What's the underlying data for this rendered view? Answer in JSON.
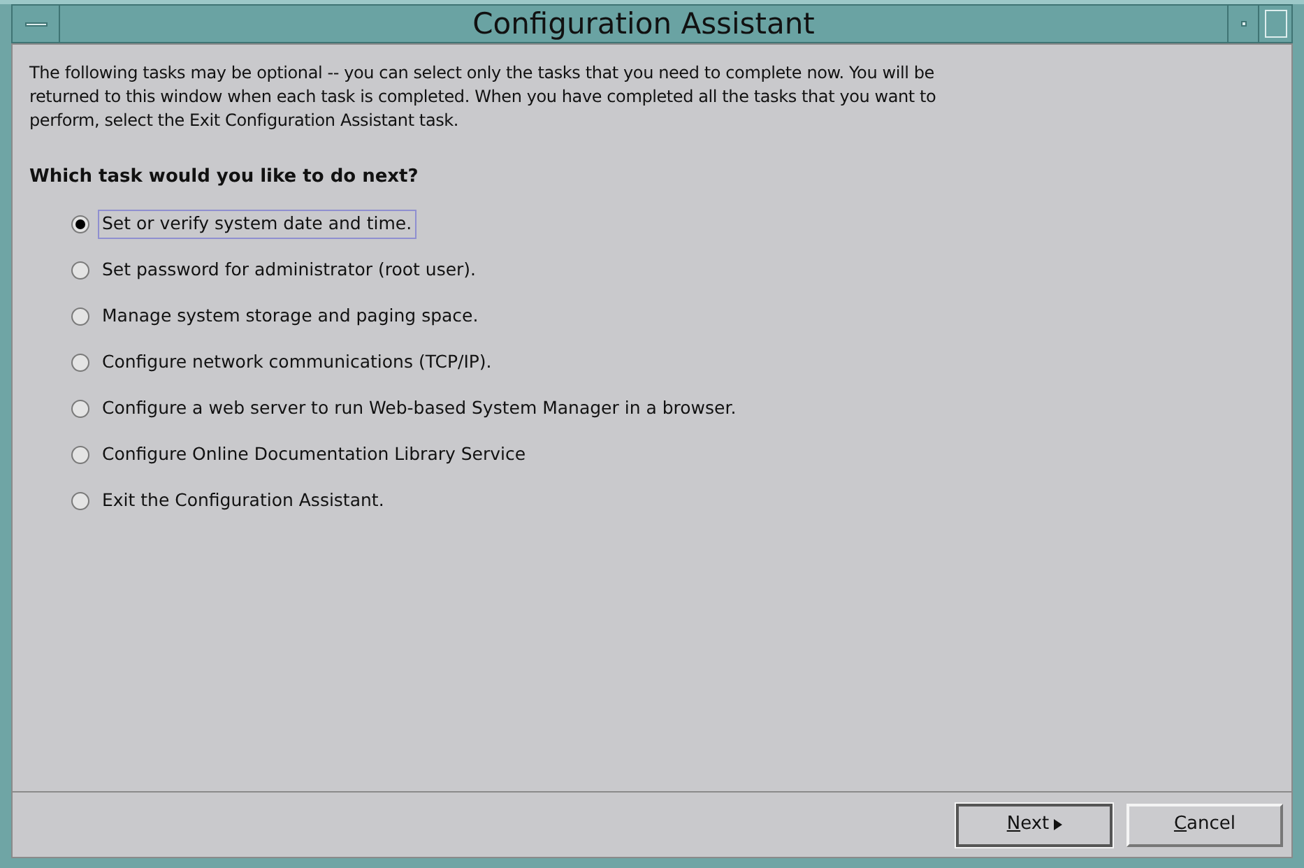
{
  "window": {
    "title": "Configuration Assistant"
  },
  "intro": "The following tasks may be optional -- you can select only the tasks that you need to complete now. You will be returned to this window when each task is completed.  When you have completed all the tasks that you want to perform, select the Exit Configuration Assistant task.",
  "question": "Which task would you like to do next?",
  "options": [
    {
      "label": "Set or verify system date and time.",
      "selected": true
    },
    {
      "label": "Set password for administrator (root user).",
      "selected": false
    },
    {
      "label": "Manage system storage and paging space.",
      "selected": false
    },
    {
      "label": "Configure network communications (TCP/IP).",
      "selected": false
    },
    {
      "label": "Configure a web server to run Web-based System Manager in a browser.",
      "selected": false
    },
    {
      "label": "Configure Online Documentation Library Service",
      "selected": false
    },
    {
      "label": "Exit the Configuration Assistant.",
      "selected": false
    }
  ],
  "buttons": [
    {
      "label": "Next",
      "first_letter_underlined": true,
      "kind": "next"
    },
    {
      "label": "Cancel",
      "first_letter_underlined": true,
      "kind": "plain"
    }
  ]
}
